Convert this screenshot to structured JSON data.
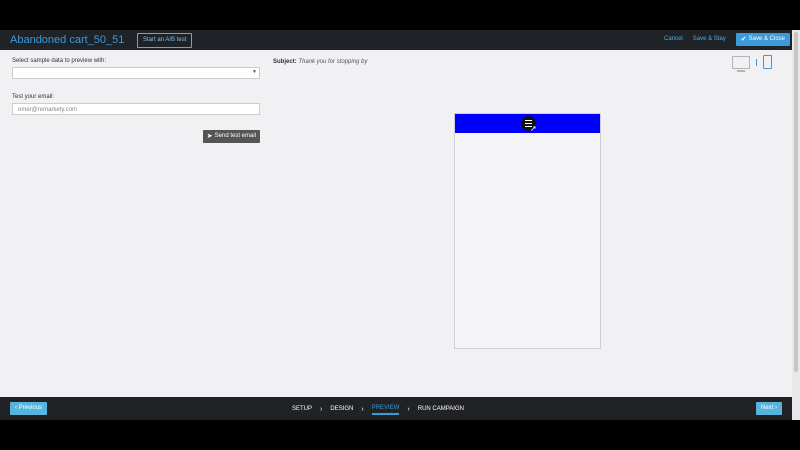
{
  "header": {
    "title": "Abandoned cart_50_51",
    "ab_test_label": "Start an A/B test",
    "cancel_label": "Cancel",
    "save_stay_label": "Save & Stay",
    "save_close_label": "Save & Close"
  },
  "preview_panel": {
    "sample_data_label": "Select sample data to preview with:",
    "test_email_label": "Test your email:",
    "test_email_value": "omer@remarkety.com",
    "send_button_label": "Send test email"
  },
  "subject": {
    "label": "Subject:",
    "value": "Thank you for stopping by"
  },
  "footer": {
    "previous_label": "Previous",
    "next_label": "Next",
    "steps": [
      "SETUP",
      "DESIGN",
      "PREVIEW",
      "RUN CAMPAIGN"
    ]
  },
  "colors": {
    "email_header": "#0000ff",
    "accent": "#3b9ad9"
  }
}
